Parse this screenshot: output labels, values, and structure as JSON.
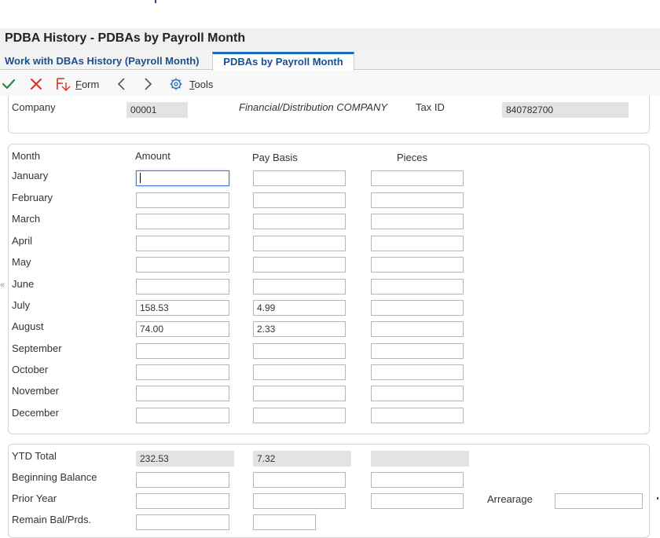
{
  "page_title": "PDBA History - PDBAs by Payroll Month",
  "tabs": [
    {
      "label": "Work with DBAs History (Payroll Month)"
    },
    {
      "label": "PDBAs by Payroll Month"
    }
  ],
  "toolbar": {
    "form_label": "Form",
    "form_mnemonic": "F",
    "form_rest": "orm",
    "tools_mnemonic": "T",
    "tools_rest": "ools",
    "ok_icon": "checkmark-icon",
    "cancel_icon": "close-icon",
    "form_icon": "form-exit-icon",
    "prev_icon": "chevron-left-icon",
    "next_icon": "chevron-right-icon",
    "tools_icon": "gear-icon",
    "accent_color": "#2a8a3a",
    "cancel_color": "#d93025"
  },
  "header": {
    "company_label": "Company",
    "company_value": "00001",
    "company_name": "Financial/Distribution COMPANY",
    "tax_id_label": "Tax ID",
    "tax_id_value": "840782700"
  },
  "grid": {
    "col_month": "Month",
    "col_amount": "Amount",
    "col_pay_basis": "Pay Basis",
    "col_pieces": "Pieces",
    "months": [
      {
        "name": "January",
        "amount": "",
        "pay_basis": "",
        "pieces": ""
      },
      {
        "name": "February",
        "amount": "",
        "pay_basis": "",
        "pieces": ""
      },
      {
        "name": "March",
        "amount": "",
        "pay_basis": "",
        "pieces": ""
      },
      {
        "name": "April",
        "amount": "",
        "pay_basis": "",
        "pieces": ""
      },
      {
        "name": "May",
        "amount": "",
        "pay_basis": "",
        "pieces": ""
      },
      {
        "name": "June",
        "amount": "",
        "pay_basis": "",
        "pieces": ""
      },
      {
        "name": "July",
        "amount": "158.53",
        "pay_basis": "4.99",
        "pieces": ""
      },
      {
        "name": "August",
        "amount": "74.00",
        "pay_basis": "2.33",
        "pieces": ""
      },
      {
        "name": "September",
        "amount": "",
        "pay_basis": "",
        "pieces": ""
      },
      {
        "name": "October",
        "amount": "",
        "pay_basis": "",
        "pieces": ""
      },
      {
        "name": "November",
        "amount": "",
        "pay_basis": "",
        "pieces": ""
      },
      {
        "name": "December",
        "amount": "",
        "pay_basis": "",
        "pieces": ""
      }
    ]
  },
  "totals": {
    "ytd_label": "YTD Total",
    "ytd_amount": "232.53",
    "ytd_pay_basis": "7.32",
    "ytd_pieces": "",
    "beginning_label": "Beginning Balance",
    "prior_year_label": "Prior Year",
    "arrearage_label": "Arrearage",
    "remain_label": "Remain Bal/Prds."
  }
}
